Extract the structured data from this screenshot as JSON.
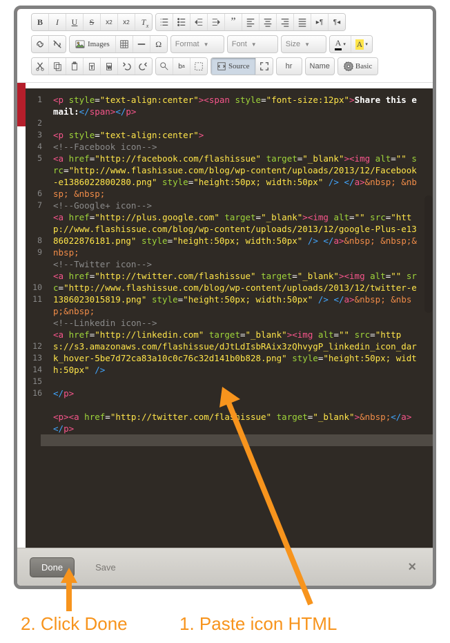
{
  "toolbar": {
    "images_label": "Images",
    "format_label": "Format",
    "font_label": "Font",
    "size_label": "Size",
    "source_label": "Source",
    "hr_label": "hr",
    "name_label": "Name",
    "basic_label": "Basic"
  },
  "code": {
    "lines": [
      "1",
      "2",
      "3",
      "4",
      "5",
      "6",
      "7",
      "8",
      "9",
      "10",
      "11",
      "\n",
      "12",
      "13",
      "14",
      "15",
      "16"
    ],
    "gutter": "1\n\n2\n3\n4\n5\n\n\n6\n7\n\n\n8\n9\n\n\n10\n11\n\n\n\n12\n13\n14\n15\n16",
    "line1_text": "Share this email:",
    "line3_attr": "style",
    "line3_val": "\"text-align:center\"",
    "fb_comment": "<!--Facebook icon-->",
    "fb_href": "\"http://facebook.com/flashissue\"",
    "fb_src": "\"http://www.flashissue.com/blog/wp-content/uploads/2013/12/Facebook-e1386022800280.png\"",
    "img_style": "\"height:50px; width:50px\"",
    "gp_comment": "<!--Google+ icon-->",
    "gp_href": "\"http://plus.google.com\"",
    "gp_src": "\"http://www.flashissue.com/blog/wp-content/uploads/2013/12/google-Plus-e1386022876181.png\"",
    "tw_comment": "<!--Twitter icon-->",
    "tw_href": "\"http://twitter.com/flashissue\"",
    "tw_src": "\"http://www.flashissue.com/blog/wp-content/uploads/2013/12/twitter-e1386023015819.png\"",
    "li_comment": "<!--Linkedin icon-->",
    "li_href": "\"http://linkedin.com\"",
    "li_src": "\"https://s3.amazonaws.com/flashissue/dJtLdIsbRAix3zQhvygP_linkedin_icon_dark_hover-5be7d72ca83a10c0c76c32d141b0b828.png\"",
    "target_val": "\"_blank\"",
    "alt_val": "\"\"",
    "fontsize_val": "\"font-size:12px\"",
    "line15_href": "\"http://twitter.com/flashissue\""
  },
  "footer": {
    "done": "Done",
    "save": "Save",
    "close": "×"
  },
  "annotations": {
    "step1": "1. Paste icon HTML",
    "step2": "2. Click Done"
  }
}
